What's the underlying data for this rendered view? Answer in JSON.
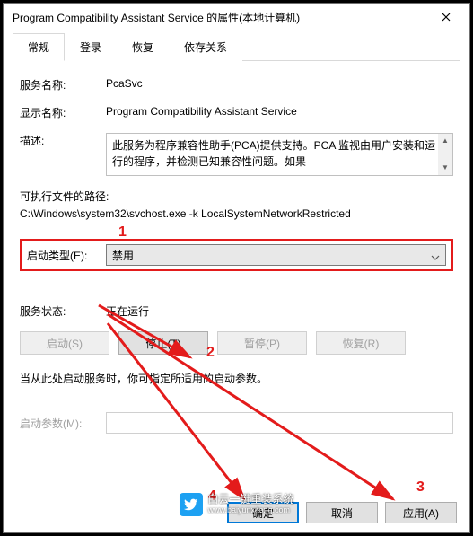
{
  "window": {
    "title": "Program Compatibility Assistant Service 的属性(本地计算机)"
  },
  "tabs": [
    "常规",
    "登录",
    "恢复",
    "依存关系"
  ],
  "general": {
    "service_name_label": "服务名称:",
    "service_name_value": "PcaSvc",
    "display_name_label": "显示名称:",
    "display_name_value": "Program Compatibility Assistant Service",
    "description_label": "描述:",
    "description_value": "此服务为程序兼容性助手(PCA)提供支持。PCA 监视由用户安装和运行的程序，并检测已知兼容性问题。如果",
    "exe_path_label": "可执行文件的路径:",
    "exe_path_value": "C:\\Windows\\system32\\svchost.exe -k LocalSystemNetworkRestricted",
    "startup_type_label": "启动类型(E):",
    "startup_type_value": "禁用",
    "status_label": "服务状态:",
    "status_value": "正在运行",
    "hint": "当从此处启动服务时，你可指定所适用的启动参数。",
    "param_label": "启动参数(M):",
    "param_value": ""
  },
  "buttons": {
    "start": "启动(S)",
    "stop": "停止(T)",
    "pause": "暂停(P)",
    "resume": "恢复(R)",
    "ok": "确定",
    "cancel": "取消",
    "apply": "应用(A)"
  },
  "annotations": {
    "n1": "1",
    "n2": "2",
    "n3": "3",
    "n4": "4"
  },
  "watermark": {
    "line1": "白云一键重装系统",
    "line2": "www.baiyunxitong.com"
  },
  "colors": {
    "highlight": "#e31b1b"
  }
}
